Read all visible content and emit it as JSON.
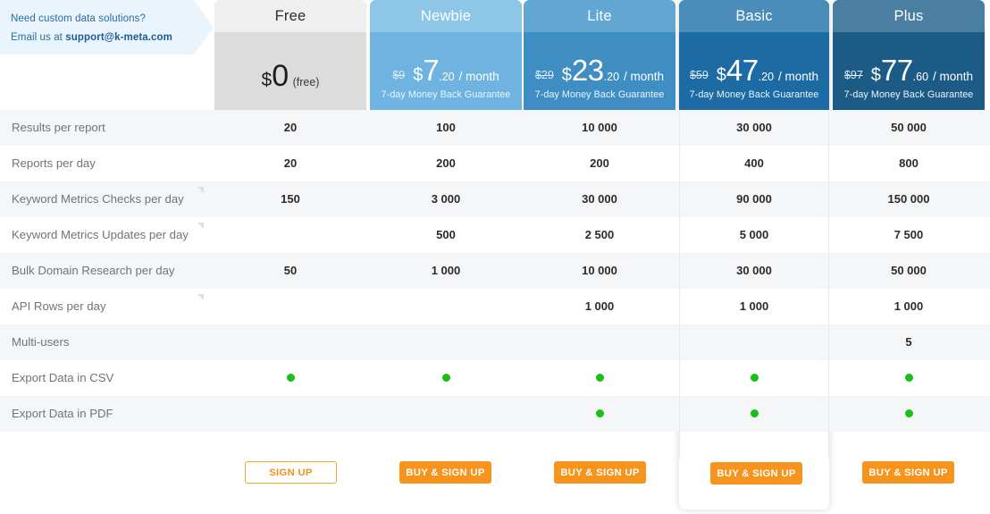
{
  "promo": {
    "line1": "Need custom data solutions?",
    "line2_prefix": "Email us at ",
    "email": "support@k-meta.com"
  },
  "plans": [
    {
      "id": "free",
      "name": "Free",
      "old_price": "",
      "currency": "$",
      "amount": "0",
      "cents": "",
      "period": "",
      "free_note": "(free)",
      "guarantee": "",
      "cta": "SIGN UP",
      "cta_style": "outline",
      "highlighted": false,
      "header_bg": "#dcdcdc",
      "title_bg": "#efefef"
    },
    {
      "id": "newbie",
      "name": "Newbie",
      "old_price": "$9",
      "currency": "$",
      "amount": "7",
      "cents": ".20",
      "period": "/ month",
      "free_note": "",
      "guarantee": "7-day Money Back Guarantee",
      "cta": "BUY & SIGN UP",
      "cta_style": "solid",
      "highlighted": false,
      "header_bg": "#6fb4e0",
      "title_bg": "#8ec6e8"
    },
    {
      "id": "lite",
      "name": "Lite",
      "old_price": "$29",
      "currency": "$",
      "amount": "23",
      "cents": ".20",
      "period": "/ month",
      "free_note": "",
      "guarantee": "7-day Money Back Guarantee",
      "cta": "BUY & SIGN UP",
      "cta_style": "solid",
      "highlighted": false,
      "header_bg": "#3e8ec4",
      "title_bg": "#62a6d2"
    },
    {
      "id": "basic",
      "name": "Basic",
      "old_price": "$59",
      "currency": "$",
      "amount": "47",
      "cents": ".20",
      "period": "/ month",
      "free_note": "",
      "guarantee": "7-day Money Back Guarantee",
      "cta": "BUY & SIGN UP",
      "cta_style": "solid",
      "highlighted": true,
      "header_bg": "#1c6ba5",
      "title_bg": "#4a8cba"
    },
    {
      "id": "plus",
      "name": "Plus",
      "old_price": "$97",
      "currency": "$",
      "amount": "77",
      "cents": ".60",
      "period": "/ month",
      "free_note": "",
      "guarantee": "7-day Money Back Guarantee",
      "cta": "BUY & SIGN UP",
      "cta_style": "solid",
      "highlighted": false,
      "header_bg": "#1c5b85",
      "title_bg": "#4a7fa2"
    }
  ],
  "features": [
    {
      "label": "Results per report",
      "has_tooltip": false,
      "values": [
        "20",
        "100",
        "10 000",
        "30 000",
        "50 000"
      ]
    },
    {
      "label": "Reports per day",
      "has_tooltip": false,
      "values": [
        "20",
        "200",
        "200",
        "400",
        "800"
      ]
    },
    {
      "label": "Keyword Metrics Checks per day",
      "has_tooltip": true,
      "values": [
        "150",
        "3 000",
        "30 000",
        "90 000",
        "150 000"
      ]
    },
    {
      "label": "Keyword Metrics Updates per day",
      "has_tooltip": true,
      "values": [
        "",
        "500",
        "2 500",
        "5 000",
        "7 500"
      ]
    },
    {
      "label": "Bulk Domain Research per day",
      "has_tooltip": false,
      "values": [
        "50",
        "1 000",
        "10 000",
        "30 000",
        "50 000"
      ]
    },
    {
      "label": "API Rows per day",
      "has_tooltip": true,
      "values": [
        "",
        "",
        "1 000",
        "1 000",
        "1 000"
      ]
    },
    {
      "label": "Multi-users",
      "has_tooltip": false,
      "values": [
        "",
        "",
        "",
        "",
        "5"
      ]
    },
    {
      "label": "Export Data in CSV",
      "has_tooltip": false,
      "values": [
        "dot",
        "dot",
        "dot",
        "dot",
        "dot"
      ]
    },
    {
      "label": "Export Data in PDF",
      "has_tooltip": false,
      "values": [
        "",
        "",
        "dot",
        "dot",
        "dot"
      ]
    }
  ],
  "colors": {
    "accent_orange": "#f7941d",
    "check_green": "#18c018",
    "promo_bg": "#eaf4fc",
    "promo_text": "#2b6ca3",
    "row_alt": "#f5f6f8"
  }
}
